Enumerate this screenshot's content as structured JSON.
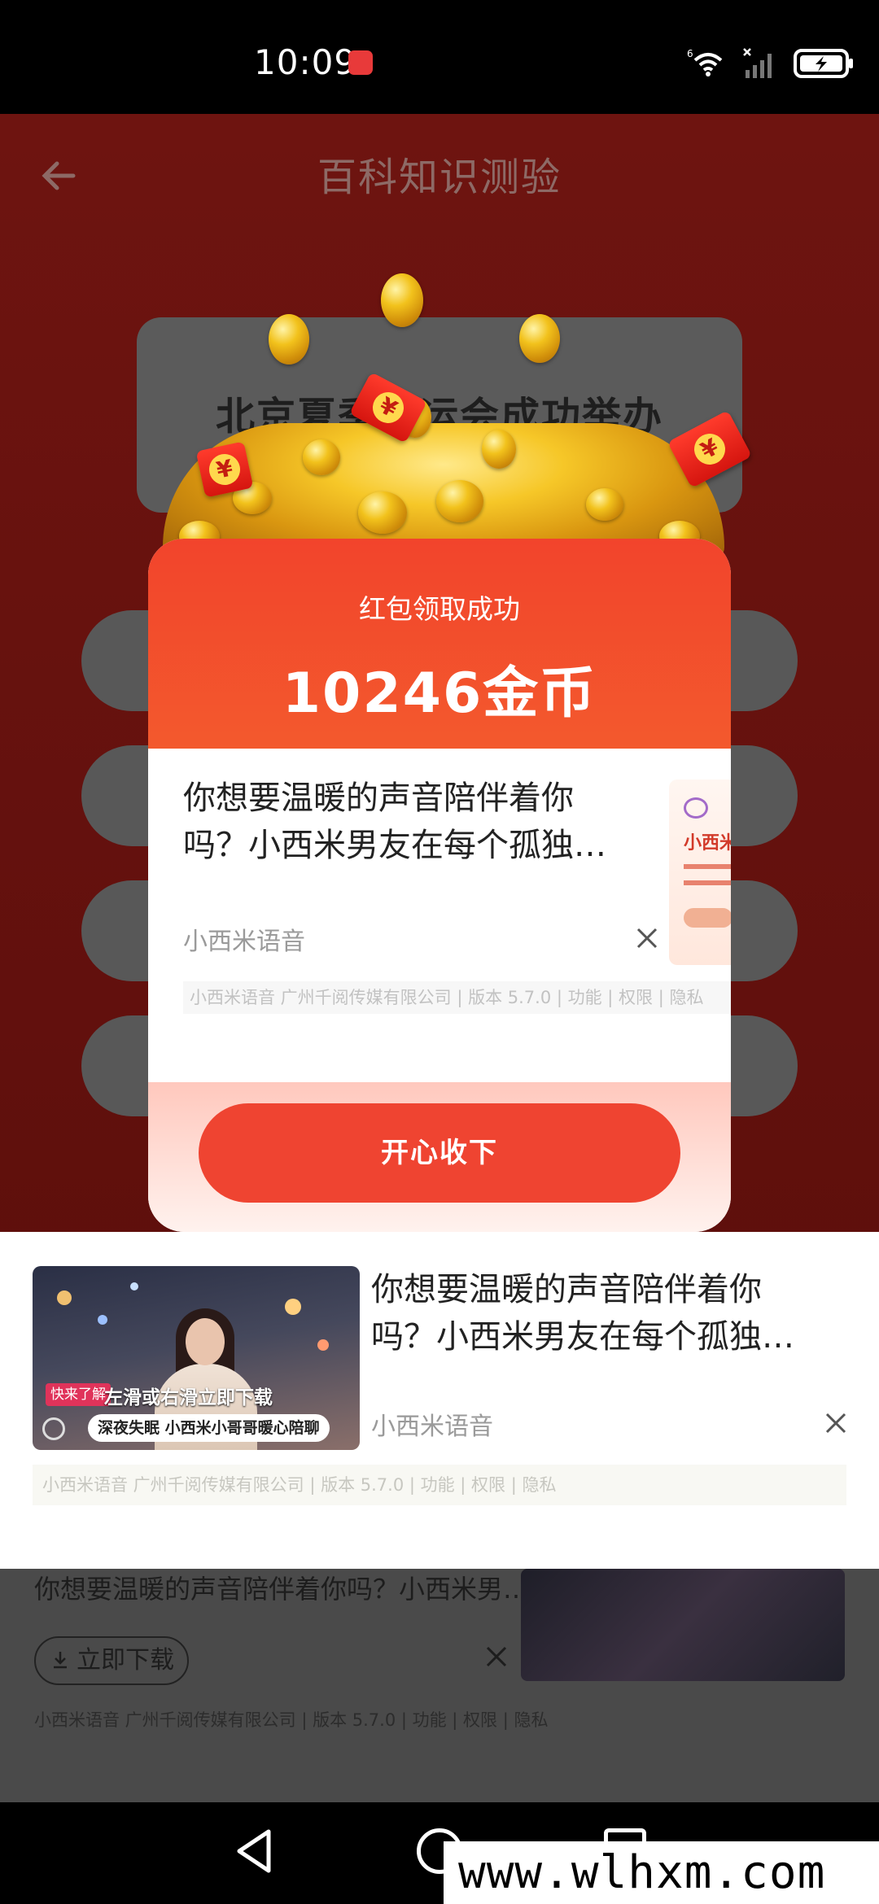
{
  "status_bar": {
    "time": "10:09",
    "app_icon": "huawei-app-icon",
    "icons": [
      "wifi-6-icon",
      "signal-icon",
      "battery-charging-icon"
    ]
  },
  "header": {
    "back_icon": "arrow-left-icon",
    "title": "百科知识测验"
  },
  "question": {
    "text": "北京夏季奥运会成功举办"
  },
  "answer_options_count": 4,
  "popup": {
    "subtitle": "红包领取成功",
    "amount": "10246金币",
    "ad": {
      "line1": "你想要温暖的声音陪伴着你",
      "line2": "吗？小西米男友在每个孤独…",
      "advertiser": "小西米语音",
      "footer": "小西米语音 广州千阅传媒有限公司 | 版本 5.7.0 | 功能 | 权限 | 隐私",
      "thumb_brand": "小西米",
      "close_icon": "close-icon"
    },
    "button": "开心收下",
    "colors": {
      "header": "#f2442c",
      "button": "#ef4431"
    }
  },
  "banner_ad": {
    "line1": "你想要温暖的声音陪伴着你",
    "line2": "吗？小西米男友在每个孤独…",
    "advertiser": "小西米语音",
    "footer": "小西米语音 广州千阅传媒有限公司 | 版本 5.7.0 | 功能 | 权限 | 隐私",
    "thumb_tag": "快来了解",
    "thumb_slide": "左滑或右滑立即下载",
    "thumb_caption": "深夜失眠 小西米小哥哥暖心陪聊",
    "close_icon": "close-icon"
  },
  "bottom_ad": {
    "text": "你想要温暖的声音陪伴着你吗？小西米男…",
    "download": "立即下载",
    "footer": "小西米语音 广州千阅传媒有限公司 | 版本 5.7.0 | 功能 | 权限 | 隐私"
  },
  "nav_bar": {
    "icons": [
      "nav-back-icon",
      "nav-home-icon",
      "nav-recent-icon"
    ]
  },
  "watermark": "www.wlhxm.com"
}
